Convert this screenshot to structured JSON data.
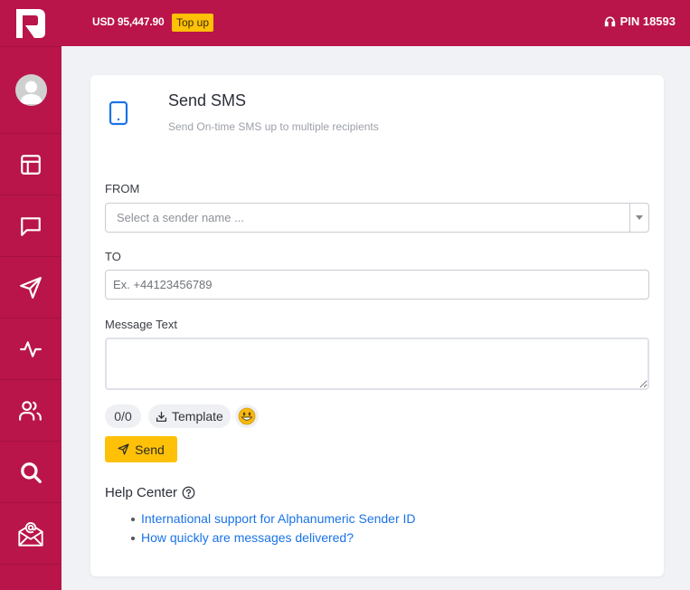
{
  "header": {
    "balance": "USD 95,447.90",
    "topup_label": "Top up",
    "pin": "PIN 18593"
  },
  "sidebar": {
    "items": [
      {
        "name": "profile",
        "icon": "avatar"
      },
      {
        "name": "dashboard",
        "icon": "layout-icon"
      },
      {
        "name": "messages",
        "icon": "chat-icon"
      },
      {
        "name": "send",
        "icon": "send-icon"
      },
      {
        "name": "activity",
        "icon": "activity-icon"
      },
      {
        "name": "contacts",
        "icon": "users-icon"
      },
      {
        "name": "search",
        "icon": "search-icon"
      },
      {
        "name": "email",
        "icon": "email-icon"
      }
    ]
  },
  "card": {
    "title": "Send SMS",
    "subtitle": "Send On-time SMS up to multiple recipients",
    "from_label": "FROM",
    "from_placeholder": "Select a sender name ...",
    "to_label": "TO",
    "to_placeholder": "Ex. +44123456789",
    "message_label": "Message Text",
    "counter": "0/0",
    "template_label": "Template",
    "send_label": "Send",
    "help_title": "Help Center",
    "help_links": [
      "International support for Alphanumeric Sender ID",
      "How quickly are messages delivered?"
    ]
  },
  "colors": {
    "brand": "#b9154a",
    "accent": "#ffc107",
    "link": "#1a73e8"
  }
}
